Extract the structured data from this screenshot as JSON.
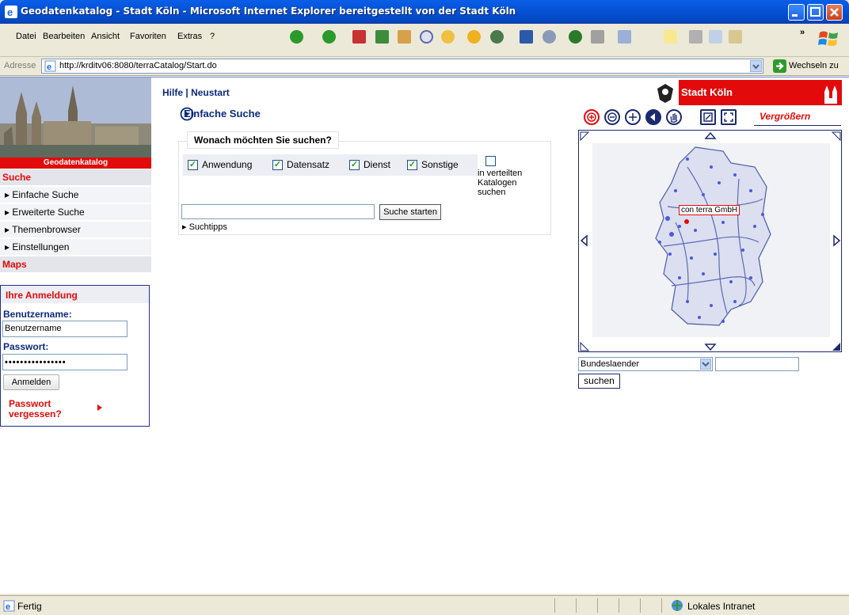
{
  "window": {
    "title": "Geodatenkatalog - Stadt Köln - Microsoft Internet Explorer bereitgestellt von der Stadt Köln"
  },
  "menu": [
    "Datei",
    "Bearbeiten",
    "Ansicht",
    "Favoriten",
    "Extras",
    "?"
  ],
  "address": {
    "label": "Adresse",
    "url": "http://krditv06:8080/terraCatalog/Start.do",
    "go": "Wechseln zu"
  },
  "nav": {
    "banner": "Geodatenkatalog",
    "search_header": "Suche",
    "items": [
      "▸ Einfache Suche",
      "▸ Erweiterte Suche",
      "▸ Themenbrowser",
      "▸ Einstellungen"
    ],
    "maps_header": "Maps"
  },
  "login": {
    "header": "Ihre Anmeldung",
    "user_label": "Benutzername:",
    "user_value": "Benutzername",
    "pass_label": "Passwort:",
    "pass_value": "••••••••••••••••",
    "button": "Anmelden",
    "forgot_line1": "Passwort",
    "forgot_line2": "vergessen?"
  },
  "main": {
    "help": "Hilfe",
    "sep": "|",
    "restart": "Neustart",
    "title": "Einfache Suche",
    "question": "Wonach möchten Sie suchen?",
    "types": [
      "Anwendung",
      "Datensatz",
      "Dienst",
      "Sonstige"
    ],
    "distributed": [
      "in verteilten",
      "Katalogen",
      "suchen"
    ],
    "search_button": "Suche starten",
    "tips": "▸ Suchtipps"
  },
  "map": {
    "brand": "Stadt Köln",
    "mode": "Vergrößern",
    "label": "con terra GmbH",
    "select_value": "Bundeslaender",
    "search_button": "suchen"
  },
  "status": {
    "left": "Fertig",
    "zone": "Lokales Intranet"
  }
}
